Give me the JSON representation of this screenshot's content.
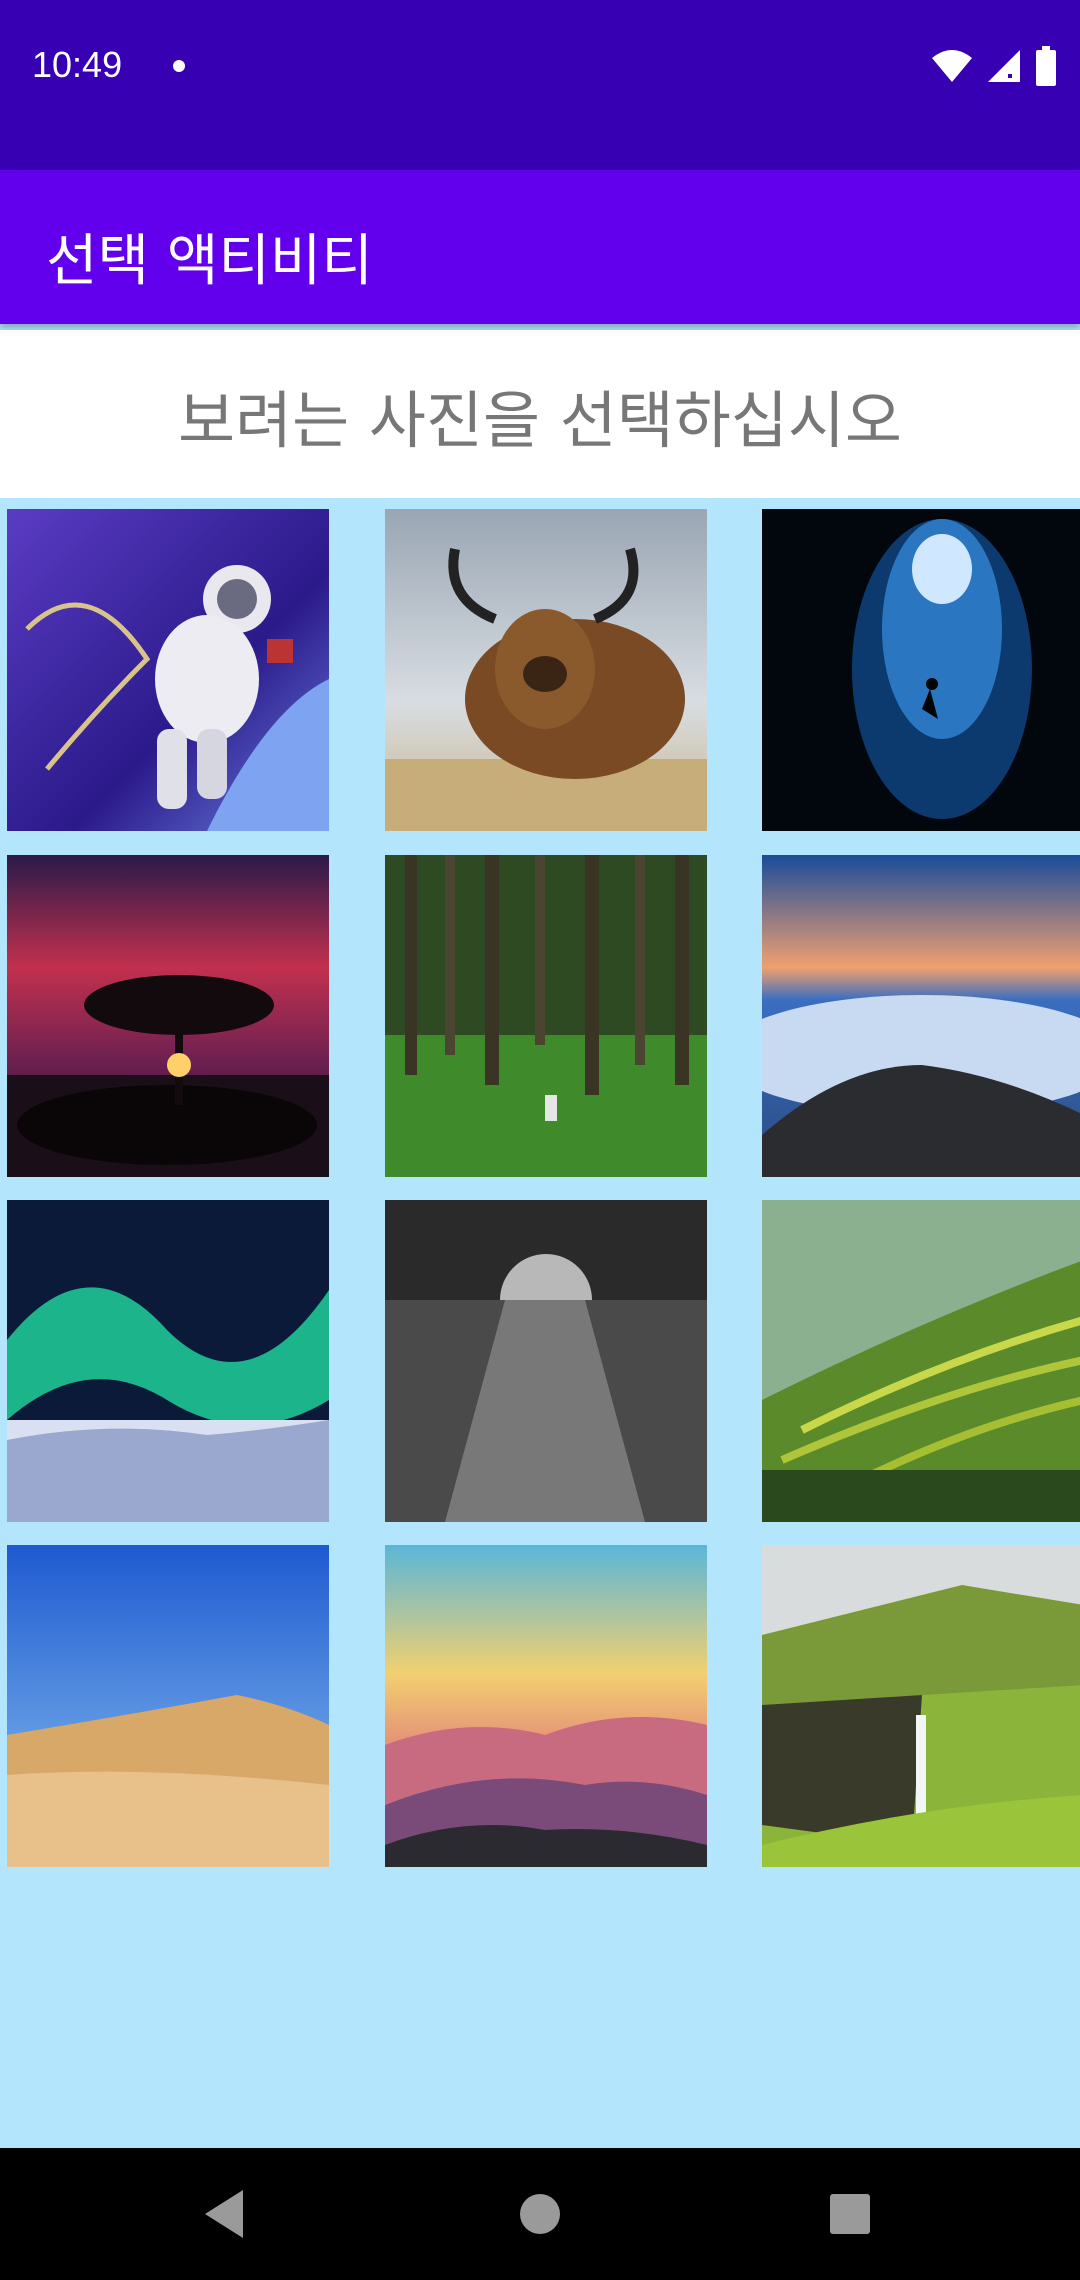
{
  "status_bar": {
    "time": "10:49",
    "icons": [
      "notification-dot-icon",
      "wifi-icon",
      "signal-icon",
      "battery-icon"
    ]
  },
  "app_bar": {
    "title": "선택 액티비티"
  },
  "prompt": {
    "text": "보려는 사진을 선택하십시오"
  },
  "gallery": {
    "photos": [
      "astronaut",
      "highland-cattle",
      "underwater-cave",
      "sunset-tree",
      "forest",
      "clouds-summit",
      "aurora",
      "moon-ocean",
      "rice-terraces",
      "desert-dunes",
      "mountain-sunrise",
      "waterfall-cliff"
    ]
  },
  "nav_bar": {
    "icons": [
      "back-icon",
      "home-icon",
      "recents-icon"
    ]
  },
  "colors": {
    "status_bar": "#3700b3",
    "app_bar": "#6200ee",
    "background": "#b3e5fc",
    "prompt_text": "#777777"
  }
}
